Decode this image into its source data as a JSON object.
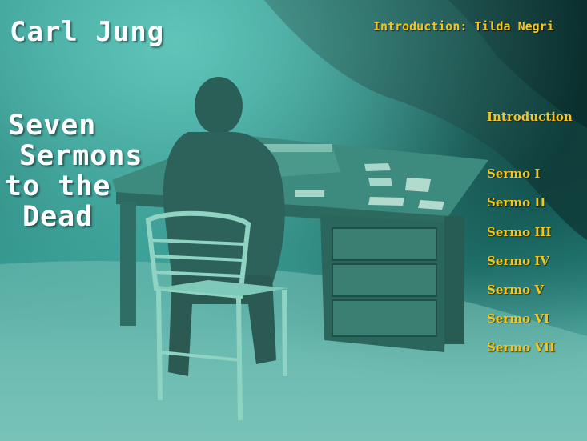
{
  "header": {
    "author": "Carl Jung",
    "title_lines": [
      "Seven",
      "Sermons",
      "to the",
      "Dead"
    ],
    "intro_credit": "Introduction: Tilda Negri"
  },
  "nav": {
    "items": [
      {
        "label": "Introduction"
      },
      {
        "label": "Sermo I"
      },
      {
        "label": "Sermo II"
      },
      {
        "label": "Sermo III"
      },
      {
        "label": "Sermo IV"
      },
      {
        "label": "Sermo V"
      },
      {
        "label": "Sermo VI"
      },
      {
        "label": "Sermo VII"
      }
    ]
  },
  "colors": {
    "accent": "#f3c51f",
    "title": "#ffffff",
    "water": "#1f7f7a"
  },
  "background": {
    "icon": "underwater-desk-sculpture-image"
  }
}
